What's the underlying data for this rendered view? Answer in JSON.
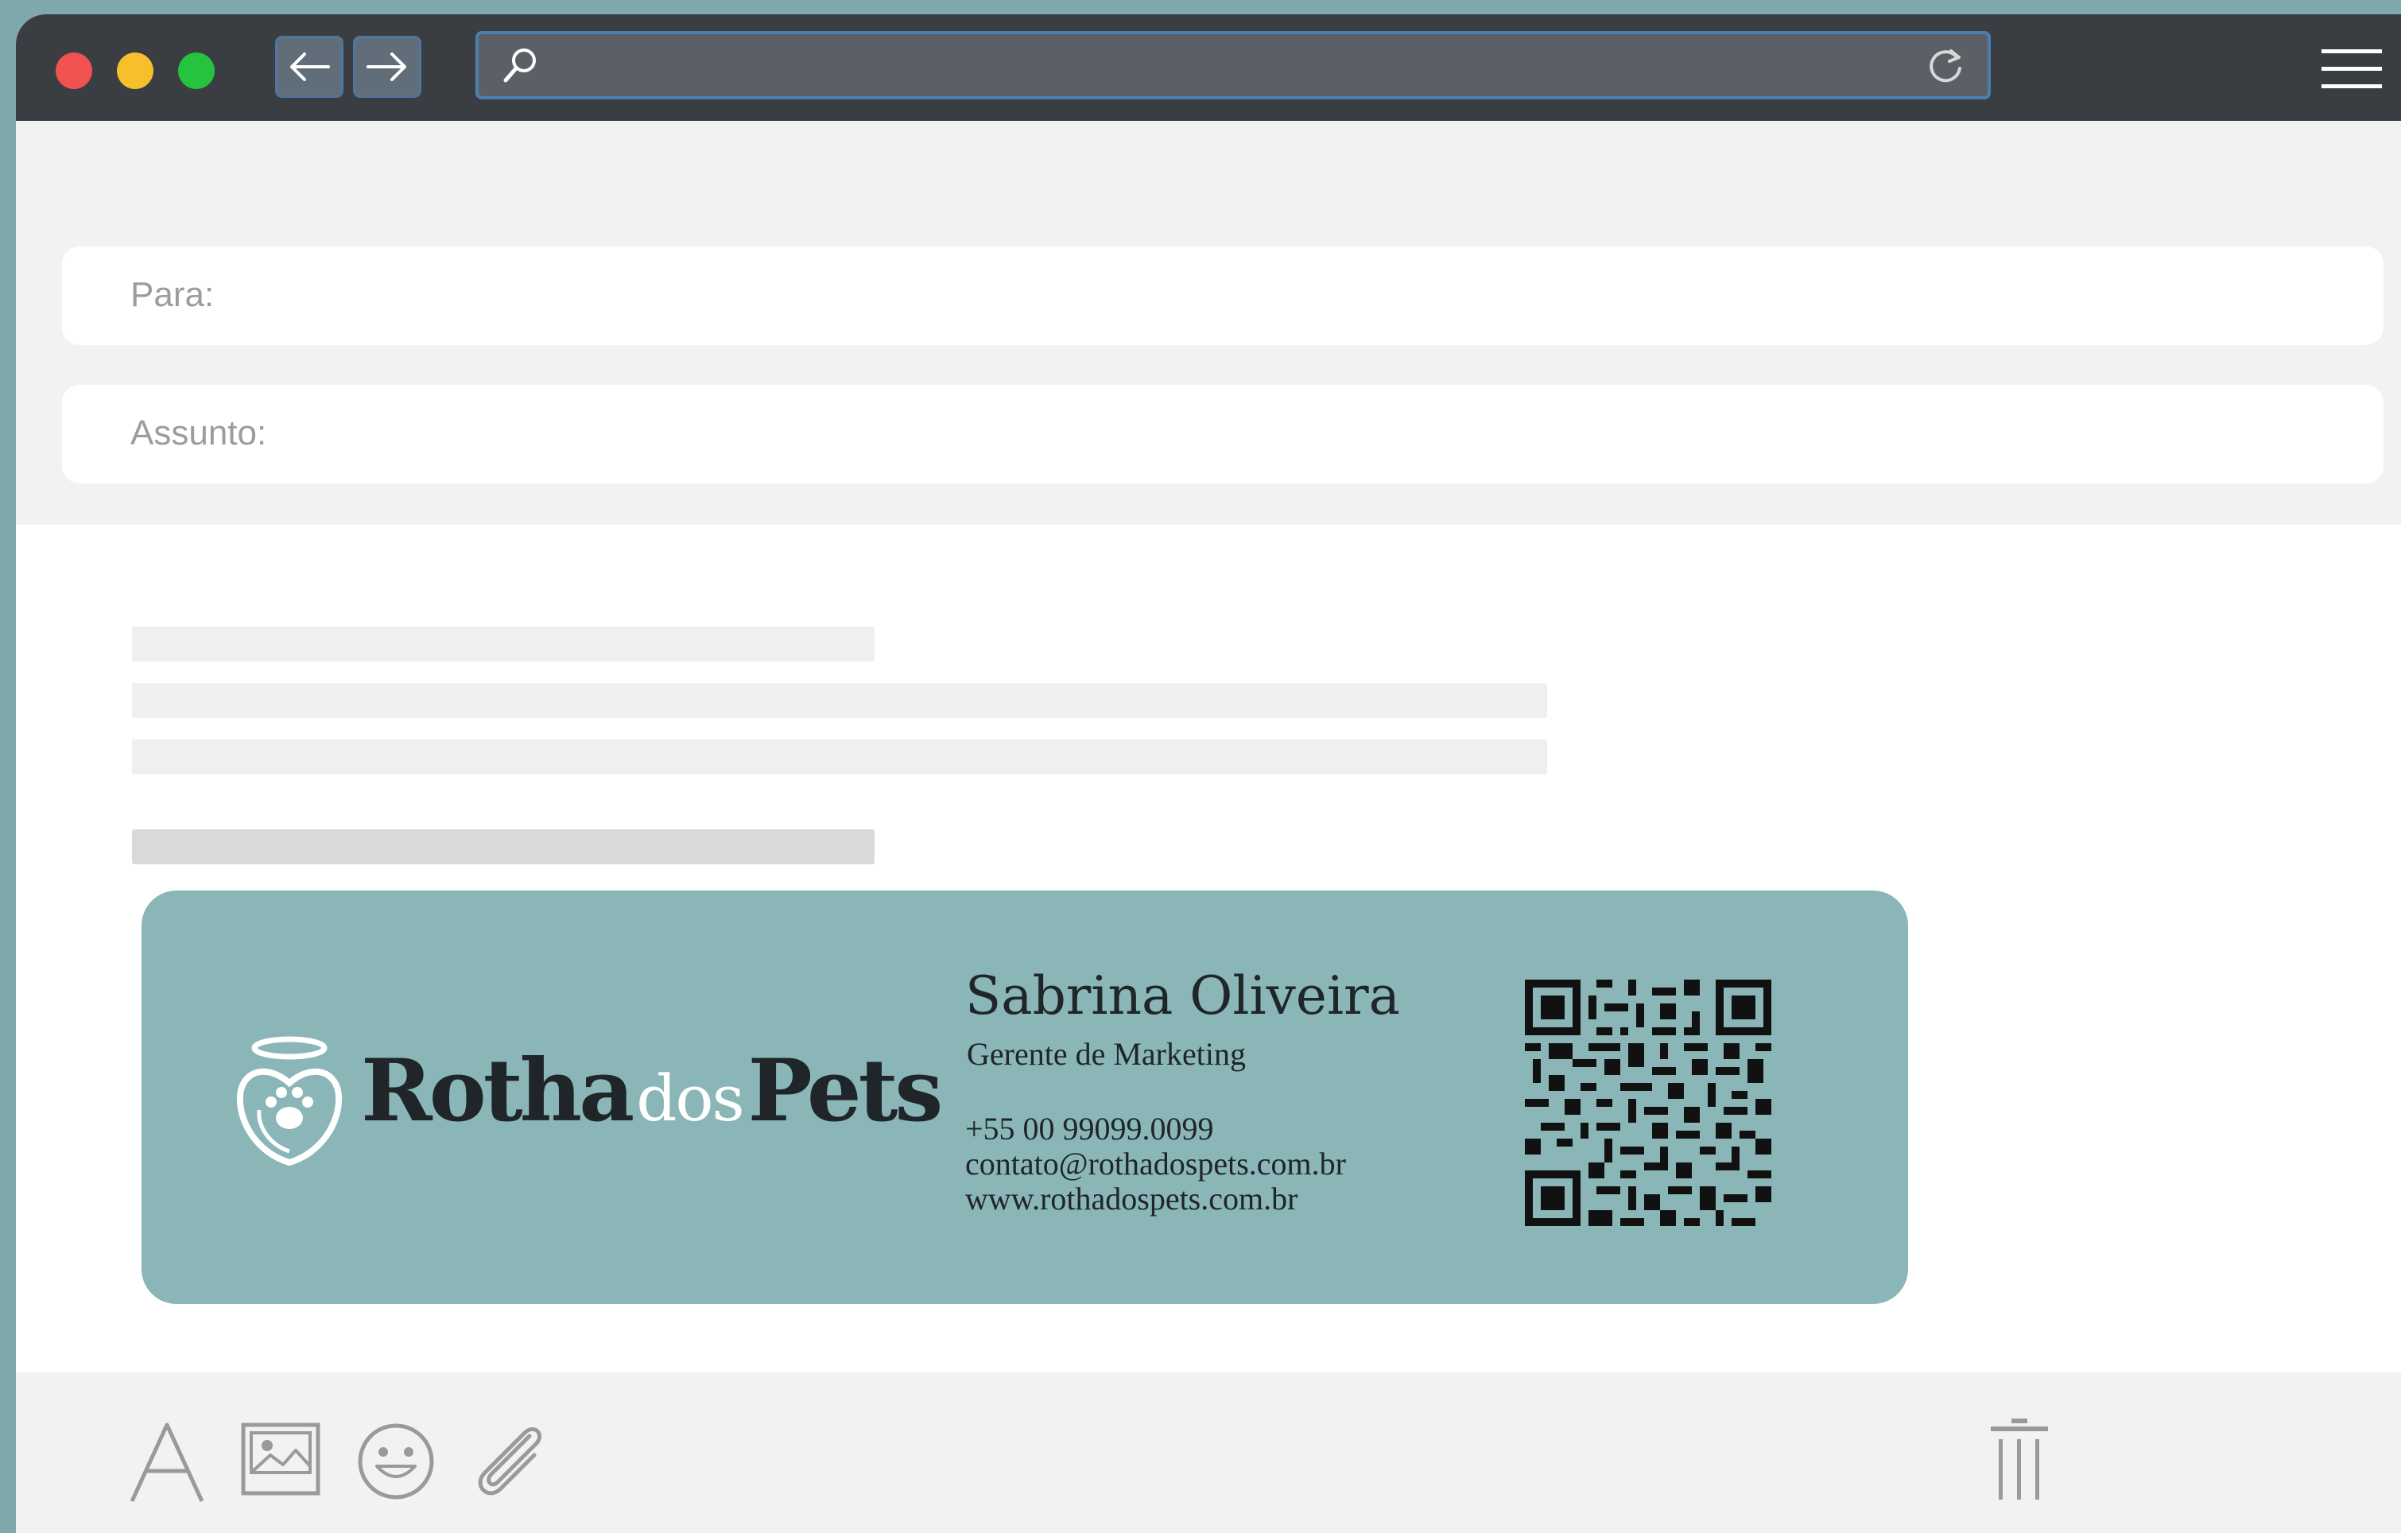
{
  "compose": {
    "to_label": "Para:",
    "subject_label": "Assunto:"
  },
  "signature": {
    "brand_part1": "Rotha",
    "brand_part2": "dos",
    "brand_part3": "Pets",
    "name": "Sabrina Oliveira",
    "role": "Gerente de Marketing",
    "phone": "+55 00 99099.0099",
    "email": "contato@rothadospets.com.br",
    "website": "www.rothadospets.com.br"
  },
  "icons": {
    "titlebar": [
      "close-dot",
      "minimize-dot",
      "maximize-dot",
      "back-arrow-icon",
      "forward-arrow-icon",
      "search-icon",
      "reload-icon",
      "menu-icon"
    ],
    "toolbar": [
      "font-icon",
      "image-icon",
      "emoji-icon",
      "attachment-icon",
      "trash-icon"
    ],
    "brand_logo": "heart-paw-halo-icon"
  },
  "colors": {
    "titlebar": "#3a3d42",
    "close": "#f0524f",
    "minimize": "#f7bf2d",
    "maximize": "#25c33e",
    "url_border": "#4c7fb0",
    "signature_bg": "#8ab6b7",
    "signature_text": "#1f2529"
  }
}
